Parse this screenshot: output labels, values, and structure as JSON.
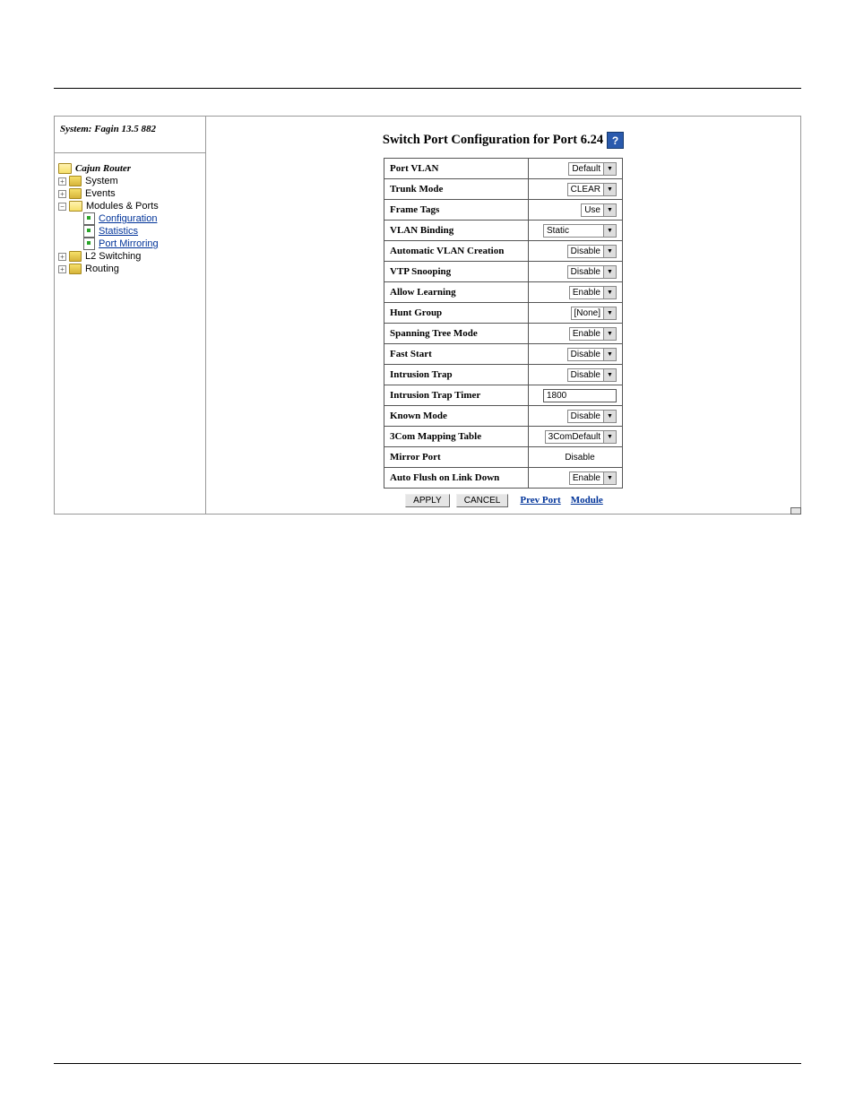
{
  "sidebar": {
    "header": "System: Fagin 13.5 882",
    "root": "Cajun Router",
    "items": [
      {
        "label": "System",
        "glyph": "+"
      },
      {
        "label": "Events",
        "glyph": "+"
      },
      {
        "label": "Modules & Ports",
        "glyph": "−",
        "children": [
          {
            "label": "Configuration"
          },
          {
            "label": "Statistics"
          },
          {
            "label": "Port Mirroring"
          }
        ]
      },
      {
        "label": "L2 Switching",
        "glyph": "+"
      },
      {
        "label": "Routing",
        "glyph": "+"
      }
    ]
  },
  "main": {
    "title": "Switch Port Configuration for Port 6.24",
    "rows": [
      {
        "label": "Port VLAN",
        "type": "select-sm",
        "value": "Default"
      },
      {
        "label": "Trunk Mode",
        "type": "select-sm",
        "value": "CLEAR"
      },
      {
        "label": "Frame Tags",
        "type": "select-sm",
        "value": "Use"
      },
      {
        "label": "VLAN Binding",
        "type": "select-full",
        "value": "Static"
      },
      {
        "label": "Automatic VLAN Creation",
        "type": "select-sm",
        "value": "Disable"
      },
      {
        "label": "VTP Snooping",
        "type": "select-sm",
        "value": "Disable"
      },
      {
        "label": "Allow Learning",
        "type": "select-sm",
        "value": "Enable"
      },
      {
        "label": "Hunt Group",
        "type": "select-sm",
        "value": "[None]"
      },
      {
        "label": "Spanning Tree Mode",
        "type": "select-sm",
        "value": "Enable"
      },
      {
        "label": "Fast Start",
        "type": "select-sm",
        "value": "Disable"
      },
      {
        "label": "Intrusion Trap",
        "type": "select-sm",
        "value": "Disable"
      },
      {
        "label": "Intrusion Trap Timer",
        "type": "text-full",
        "value": "1800"
      },
      {
        "label": "Known Mode",
        "type": "select-sm",
        "value": "Disable"
      },
      {
        "label": "3Com Mapping Table",
        "type": "select-sm",
        "value": "3ComDefault"
      },
      {
        "label": "Mirror Port",
        "type": "static",
        "value": "Disable"
      },
      {
        "label": "Auto Flush on Link Down",
        "type": "select-sm",
        "value": "Enable"
      }
    ],
    "buttons": {
      "apply": "APPLY",
      "cancel": "CANCEL"
    },
    "nav": {
      "prev": "Prev Port",
      "module": "Module"
    },
    "help_glyph": "?"
  }
}
